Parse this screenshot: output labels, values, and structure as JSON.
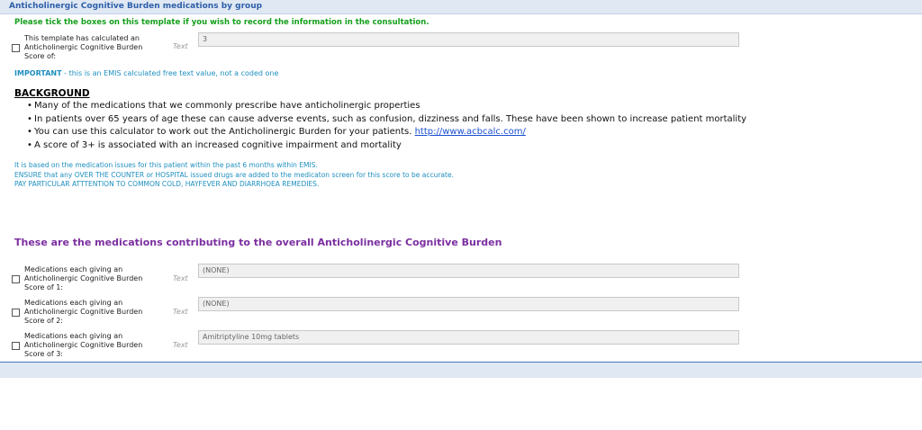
{
  "header": {
    "title": "Anticholinergic Cognitive Burden medications by group"
  },
  "instructions": "Please tick the boxes on this template if you wish to record the information in the consultation.",
  "score_row": {
    "label_lines": [
      "This template has calculated an",
      "Anticholinergic Cognitive Burden",
      "Score of:"
    ],
    "type": "Text",
    "value": "3"
  },
  "important": {
    "bold": "IMPORTANT",
    "text": " - this is an EMIS calculated free text value, not a coded one"
  },
  "background": {
    "title": "BACKGROUND",
    "bullets": [
      "Many of the medications that we commonly prescribe have anticholinergic properties",
      "In patients over 65 years of age these can cause adverse events, such as confusion, dizziness and falls. These have been shown to increase patient mortality",
      "You can use this calculator to work out the Anticholinergic Burden for your patients. ",
      "A score of 3+ is associated with an increased cognitive impairment and mortality"
    ],
    "link": "http://www.acbcalc.com/"
  },
  "notes": [
    "It is based on the medication issues for this patient within the past 6 months within EMIS.",
    "ENSURE that any OVER THE COUNTER or HOSPITAL issued drugs are added to the medicaton screen for this score to be accurate.",
    "PAY PARTICULAR ATTTENTION TO COMMON COLD, HAYFEVER AND DIARRHOEA REMEDIES."
  ],
  "section_title": "These are the medications contributing to the overall Anticholinergic Cognitive Burden",
  "med_rows": [
    {
      "label_lines": [
        "Medications each giving an",
        "Anticholinergic Cognitive Burden",
        "Score of 1:"
      ],
      "type": "Text",
      "value": "(NONE)"
    },
    {
      "label_lines": [
        "Medications each giving an",
        "Anticholinergic Cognitive Burden",
        "Score of 2:"
      ],
      "type": "Text",
      "value": "(NONE)"
    },
    {
      "label_lines": [
        "Medications each giving an",
        "Anticholinergic Cognitive Burden",
        "Score of 3:"
      ],
      "type": "Text",
      "value": "Amitriptyline 10mg tablets"
    }
  ]
}
